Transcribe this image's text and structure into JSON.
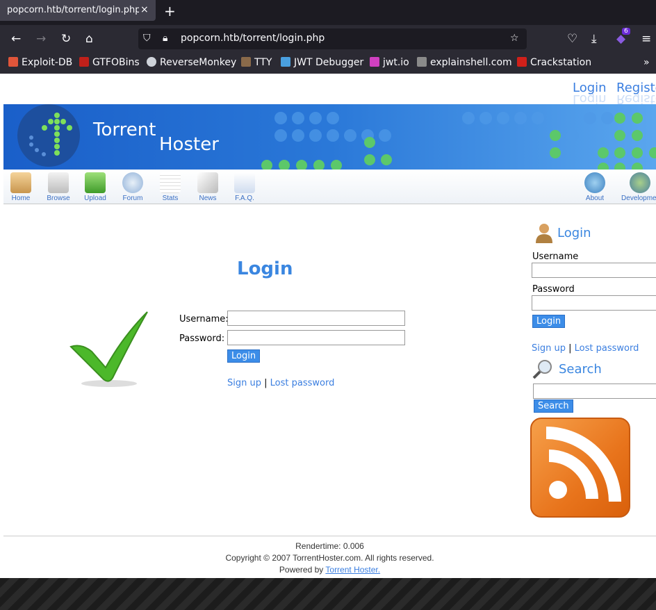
{
  "browser": {
    "tab_title": "popcorn.htb/torrent/login.php",
    "tab_close": "×",
    "new_tab": "+",
    "url": "popcorn.htb/torrent/login.php",
    "extension_badge": "6",
    "bookmarks": [
      {
        "label": "Exploit-DB",
        "color": "#e0553a"
      },
      {
        "label": "GTFOBins",
        "color": "#c0201a"
      },
      {
        "label": "ReverseMonkey",
        "color": "#cfd3da"
      },
      {
        "label": "TTY",
        "color": "#8a6a4a"
      },
      {
        "label": "JWT Debugger",
        "color": "#4aa0e0"
      },
      {
        "label": "jwt.io",
        "color": "#d040c0"
      },
      {
        "label": "explainshell.com",
        "color": "#8a8a8a"
      },
      {
        "label": "Crackstation",
        "color": "#d0201a"
      }
    ]
  },
  "header": {
    "login_link": "Login",
    "register_link": "Registe",
    "logo_word1": "Torrent",
    "logo_word2": "Hoster"
  },
  "nav": [
    {
      "label": "Home",
      "icon": "home-icon"
    },
    {
      "label": "Browse",
      "icon": "browse-icon"
    },
    {
      "label": "Upload",
      "icon": "upload-icon"
    },
    {
      "label": "Forum",
      "icon": "forum-icon"
    },
    {
      "label": "Stats",
      "icon": "stats-icon"
    },
    {
      "label": "News",
      "icon": "news-icon"
    },
    {
      "label": "F.A.Q.",
      "icon": "faq-icon"
    },
    {
      "label": "About",
      "icon": "about-icon"
    },
    {
      "label": "Developmer",
      "icon": "development-icon"
    }
  ],
  "main": {
    "title": "Login",
    "username_label": "Username:",
    "password_label": "Password:",
    "username_value": "",
    "password_value": "",
    "login_button": "Login",
    "signup_link": "Sign up",
    "separator": "|",
    "lost_password_link": "Lost password"
  },
  "sidebar": {
    "login_title": "Login",
    "username_label": "Username",
    "password_label": "Password",
    "login_button": "Login",
    "signup_link": "Sign up",
    "separator": "|",
    "lost_password_link": "Lost password",
    "search_title": "Search",
    "search_value": "",
    "search_button": "Search"
  },
  "footer": {
    "rendertime": "Rendertime: 0.006",
    "copyright": "Copyright © 2007 TorrentHoster.com. All rights reserved.",
    "powered_prefix": "Powered by",
    "powered_link": "Torrent Hoster."
  }
}
